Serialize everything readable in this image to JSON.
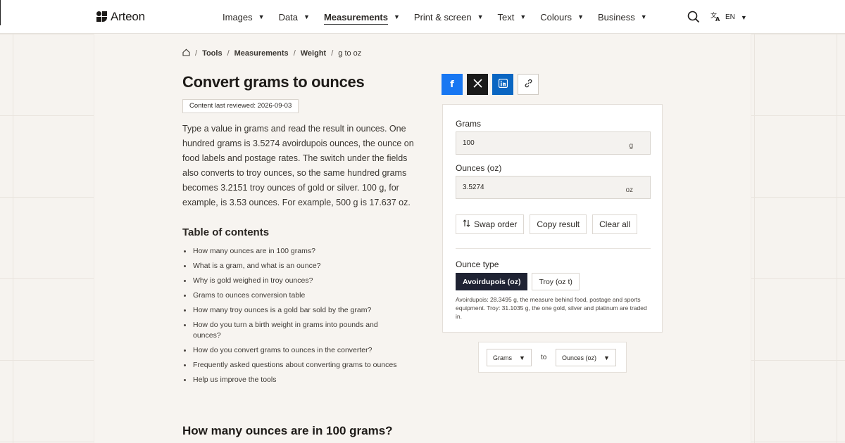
{
  "header": {
    "logo": "Arteon",
    "nav": [
      {
        "label": "Images",
        "active": false
      },
      {
        "label": "Data",
        "active": false
      },
      {
        "label": "Measurements",
        "active": true
      },
      {
        "label": "Print & screen",
        "active": false
      },
      {
        "label": "Text",
        "active": false
      },
      {
        "label": "Colours",
        "active": false
      },
      {
        "label": "Business",
        "active": false
      }
    ],
    "language": "EN"
  },
  "breadcrumb": [
    "Tools",
    "Measurements",
    "Weight",
    "g to oz"
  ],
  "page": {
    "title": "Convert grams to ounces",
    "reviewed": "Content last reviewed: 2026-09-03",
    "intro": "Type a value in grams and read the result in ounces. One hundred grams is 3.5274 avoirdupois ounces, the ounce on food labels and postage rates. The switch under the fields also converts to troy ounces, so the same hundred grams becomes 3.2151 troy ounces of gold or silver. 100 g, for example, is 3.53 ounces. For example, 500 g is 17.637 oz."
  },
  "toc": {
    "title": "Table of contents",
    "items": [
      "How many ounces are in 100 grams?",
      "What is a gram, and what is an ounce?",
      "Why is gold weighed in troy ounces?",
      "Grams to ounces conversion table",
      "How many troy ounces is a gold bar sold by the gram?",
      "How do you turn a birth weight in grams into pounds and ounces?",
      "How do you convert grams to ounces in the converter?",
      "Frequently asked questions about converting grams to ounces",
      "Help us improve the tools"
    ]
  },
  "section_heading": "How many ounces are in 100 grams?",
  "converter": {
    "grams_label": "Grams",
    "grams_value": "100",
    "grams_unit": "g",
    "ounces_label": "Ounces (oz)",
    "ounces_value": "3.5274",
    "ounces_unit": "oz",
    "swap_label": "Swap order",
    "copy_label": "Copy result",
    "clear_label": "Clear all",
    "ounce_type_label": "Ounce type",
    "avoirdupois_label": "Avoirdupois (oz)",
    "troy_label": "Troy (oz t)",
    "selected_type": "Avoirdupois (oz)",
    "note": "Avoirdupois: 28.3495 g, the measure behind food, postage and sports equipment. Troy: 31.1035 g, the one gold, silver and platinum are traded in."
  },
  "unit_selector": {
    "from": "Grams",
    "to_word": "to",
    "to": "Ounces (oz)"
  },
  "colors": {
    "accent_dark": "#1f2333",
    "facebook": "#1877f2",
    "x": "#1a1a1a",
    "linkedin": "#0a66c2",
    "background": "#f6f3ef"
  },
  "icons": [
    "home-icon",
    "search-icon",
    "translate-icon",
    "facebook-icon",
    "x-icon",
    "linkedin-icon",
    "link-icon",
    "swap-icon"
  ]
}
